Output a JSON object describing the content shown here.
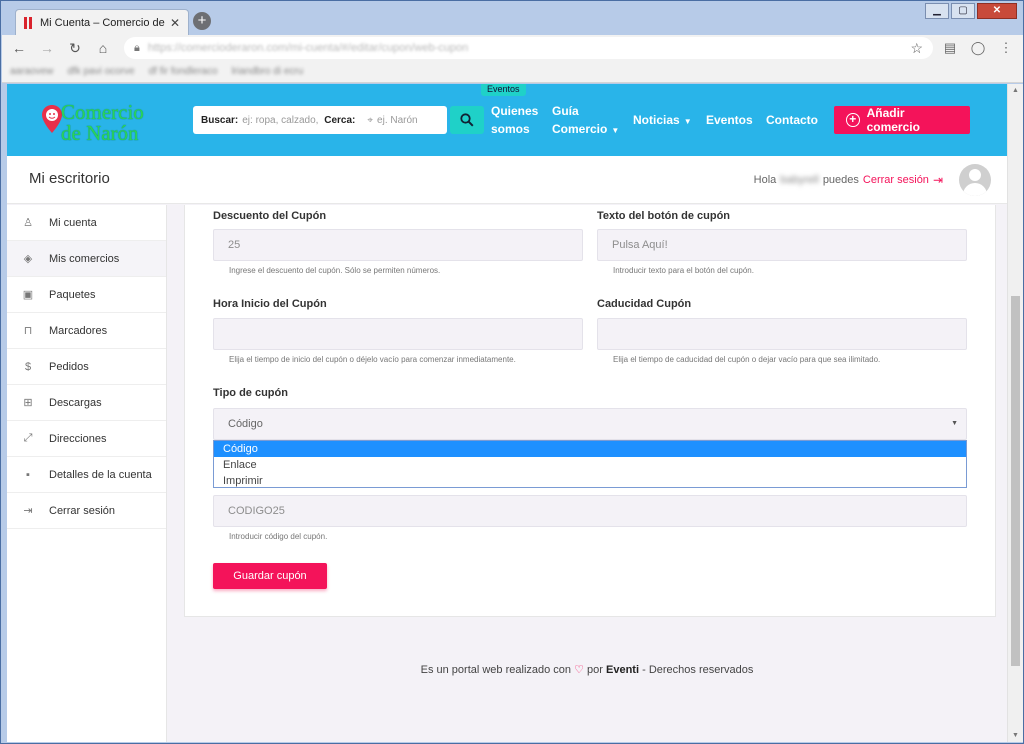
{
  "browser": {
    "tab_title": "Mi Cuenta – Comercio de Narón",
    "tab_close": "✕",
    "new_tab": "+",
    "url": "https://comercioderaron.com/mi-cuenta/#/editar/cupon/web-cupon",
    "bookmarks": [
      "aaraovew",
      "dfk pavi ocorve",
      "df fir fondleraco",
      "lriandbro di ecru"
    ]
  },
  "header": {
    "logo_line1": "Comercio",
    "logo_line2": "de Narón",
    "search_label": "Buscar:",
    "search_placeholder": "ej: ropa, calzado, r",
    "near_label": "Cerca:",
    "near_placeholder": "ej. Narón",
    "badge": "Eventos",
    "nav": [
      {
        "label_l1": "Quienes",
        "label_l2": "somos"
      },
      {
        "label_l1": "Guía",
        "label_l2": "Comercio"
      },
      {
        "label": "Noticias"
      },
      {
        "label": "Eventos"
      },
      {
        "label": "Contacto"
      }
    ],
    "add_button": "Añadir comercio"
  },
  "subheader": {
    "title": "Mi escritorio",
    "hello": "Hola",
    "username": "babyrell",
    "puedes": "puedes",
    "logout": "Cerrar sesión"
  },
  "sidebar": {
    "items": [
      {
        "label": "Mi cuenta",
        "icon": "user-icon"
      },
      {
        "label": "Mis comercios",
        "icon": "layers-icon"
      },
      {
        "label": "Paquetes",
        "icon": "package-icon"
      },
      {
        "label": "Marcadores",
        "icon": "bookmark-icon"
      },
      {
        "label": "Pedidos",
        "icon": "dollar-icon"
      },
      {
        "label": "Descargas",
        "icon": "download-icon"
      },
      {
        "label": "Direcciones",
        "icon": "expand-icon"
      },
      {
        "label": "Detalles de la cuenta",
        "icon": "account-card-icon"
      },
      {
        "label": "Cerrar sesión",
        "icon": "logout-icon"
      }
    ]
  },
  "form": {
    "discount_label": "Descuento del Cupón",
    "discount_value": "25",
    "discount_help": "Ingrese el descuento del cupón. Sólo se permiten números.",
    "button_text_label": "Texto del botón de cupón",
    "button_text_placeholder": "Pulsa Aquí!",
    "button_text_help": "Introducir texto para el botón del cupón.",
    "start_label": "Hora Inicio del Cupón",
    "start_help": "Elija el tiempo de inicio del cupón o déjelo vacío para comenzar inmediatamente.",
    "expiry_label": "Caducidad Cupón",
    "expiry_help": "Elija el tiempo de caducidad del cupón o dejar vacío para que sea ilimitado.",
    "type_label": "Tipo de cupón",
    "type_selected": "Código",
    "type_options": [
      "Código",
      "Enlace",
      "Imprimir"
    ],
    "code_value": "CODIGO25",
    "code_help": "Introducir código del cupón.",
    "save_button": "Guardar cupón"
  },
  "footer": {
    "text1": "Es un portal web realizado con",
    "text2": "por",
    "brand": "Eventi",
    "text3": "- Derechos reservados"
  },
  "colors": {
    "header_bg": "#29b4e9",
    "accent": "#f4135a",
    "search_btn": "#1fd1c8",
    "logo_green": "#29d35c",
    "dropdown_selected": "#1e90ff"
  }
}
